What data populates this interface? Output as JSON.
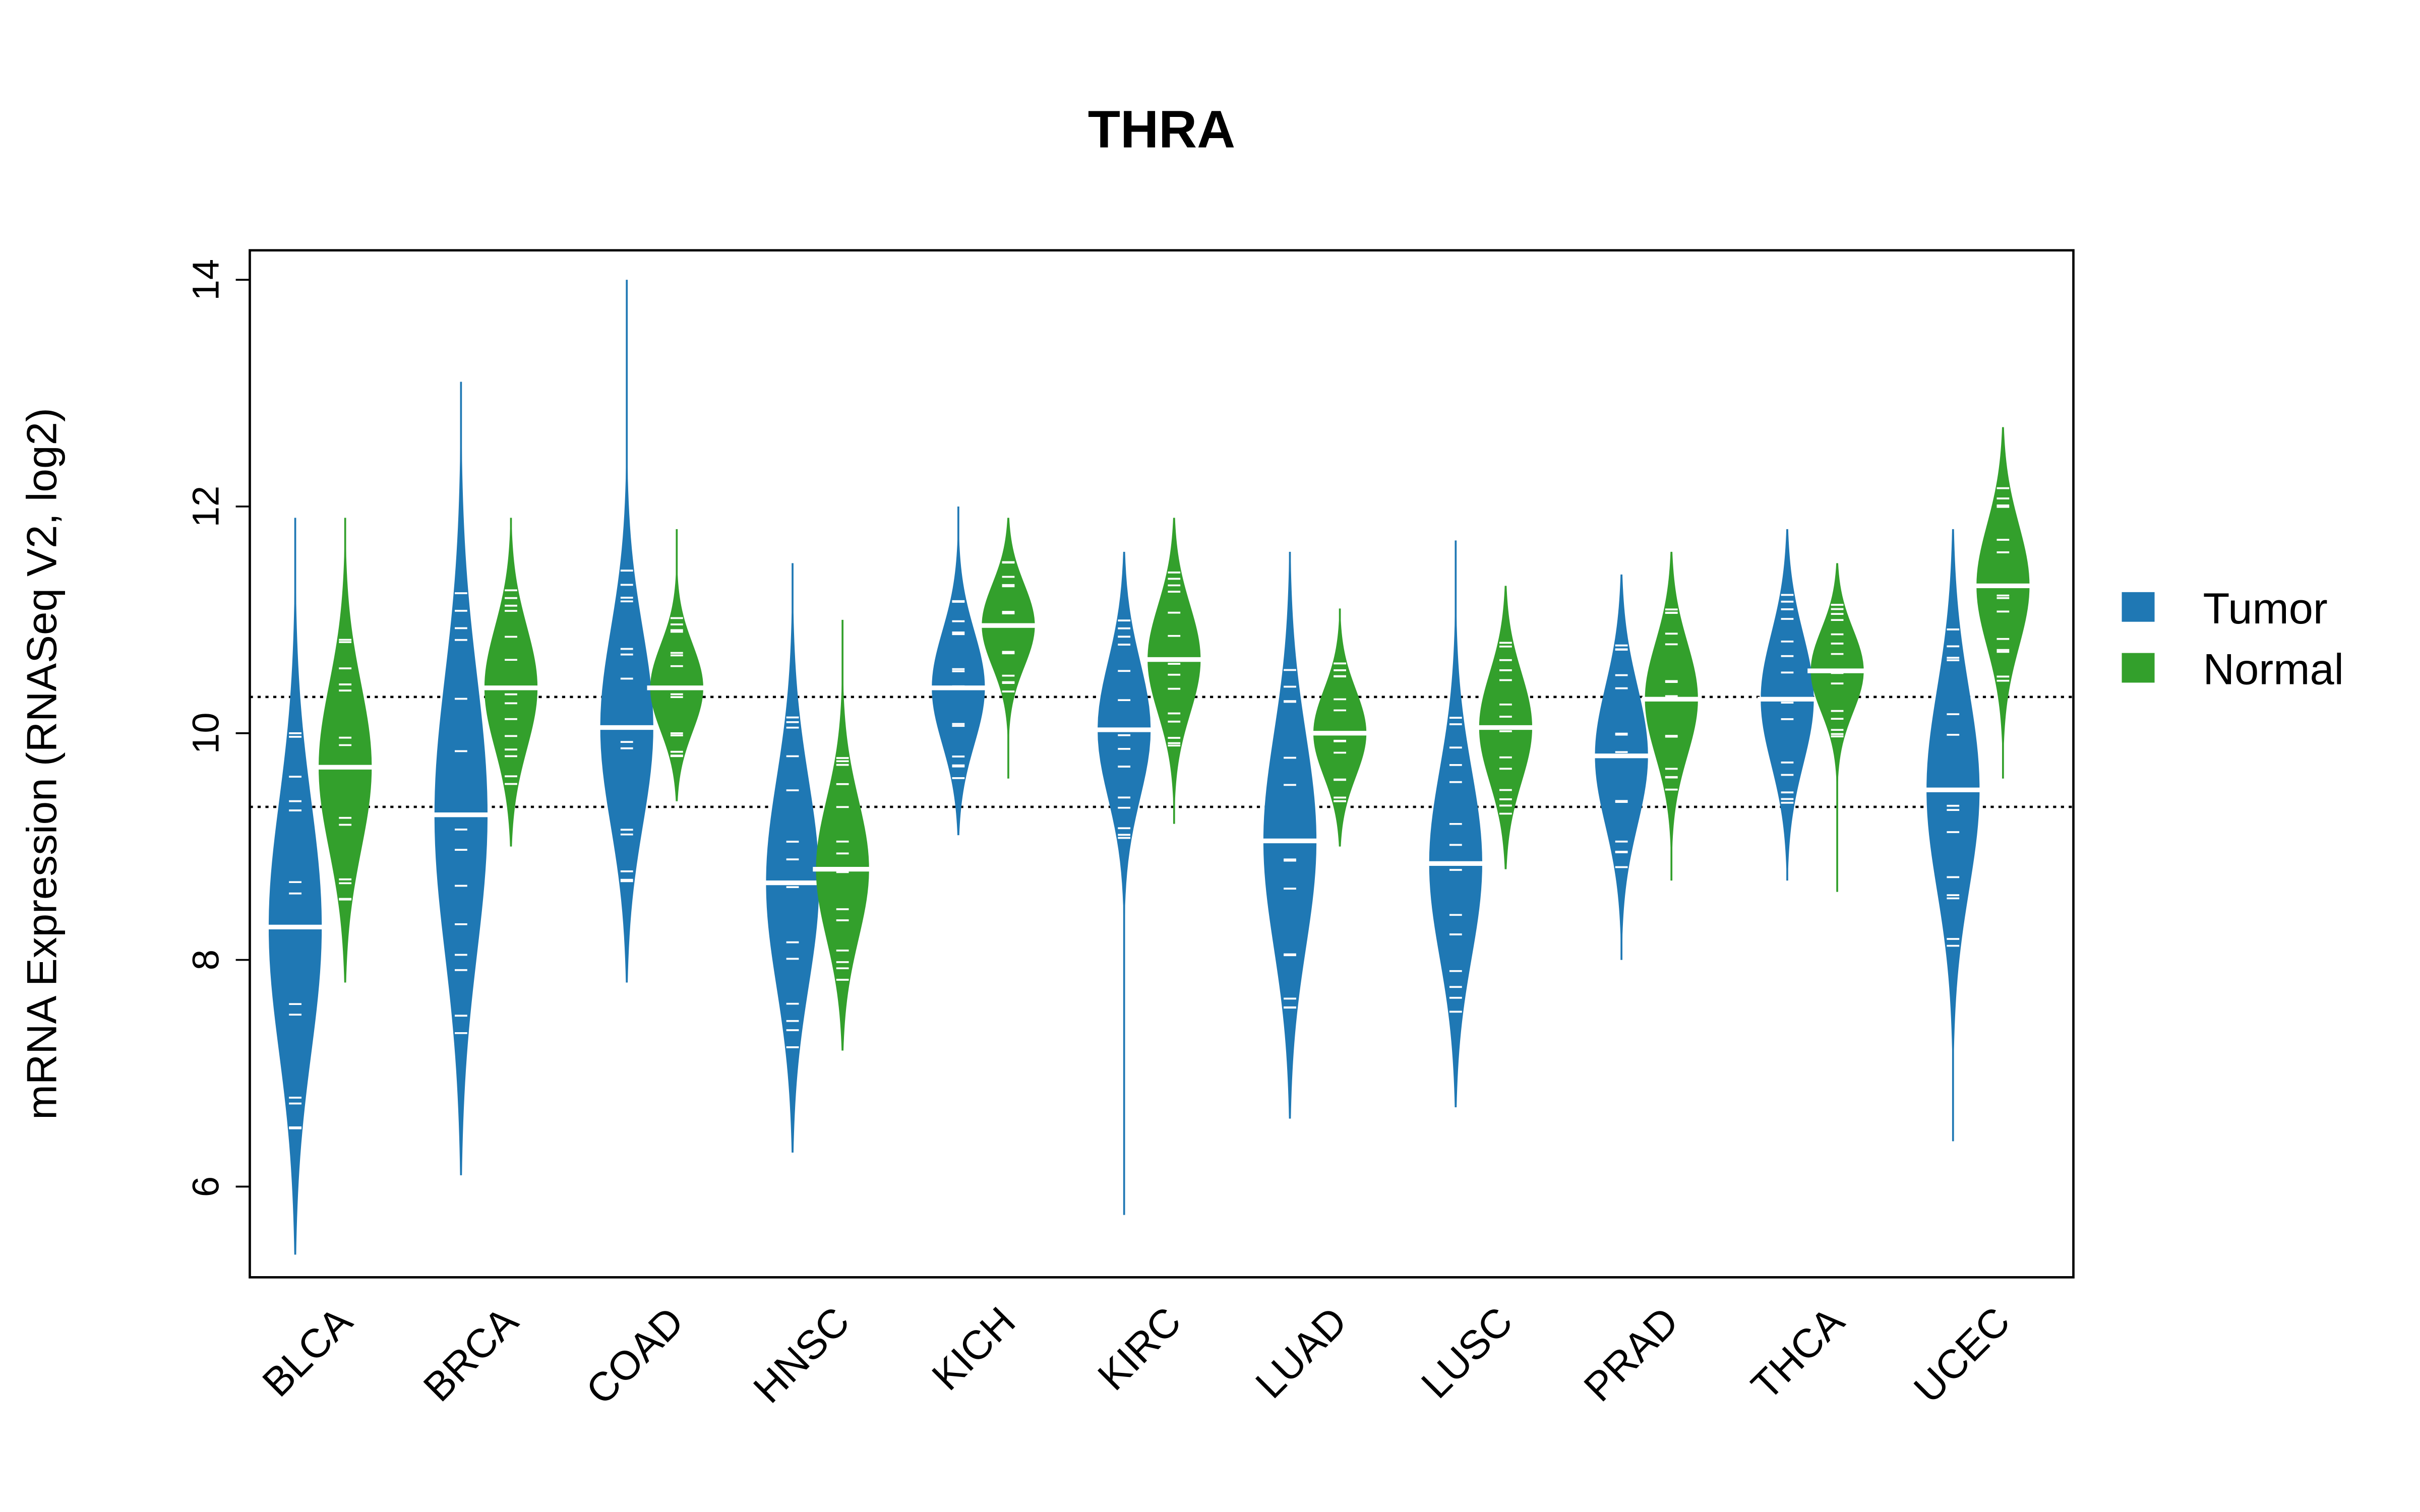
{
  "chart_data": {
    "type": "beanplot",
    "title": "THRA",
    "ylabel": "mRNA Expression (RNASeq V2, log2)",
    "xlabel": "",
    "ylim": [
      5.2,
      14.26
    ],
    "yticks": [
      6,
      8,
      10,
      12,
      14
    ],
    "categories": [
      "BLCA",
      "BRCA",
      "COAD",
      "HNSC",
      "KICH",
      "KIRC",
      "LUAD",
      "LUSC",
      "PRAD",
      "THCA",
      "UCEC"
    ],
    "reference_lines": [
      10.32,
      9.35
    ],
    "grid": false,
    "legend_position": "right",
    "series": [
      {
        "name": "Tumor",
        "color": "#1f78b4",
        "median": [
          8.29,
          9.28,
          10.05,
          8.68,
          10.4,
          10.03,
          9.05,
          8.85,
          9.8,
          10.3,
          9.5
        ],
        "min": [
          5.4,
          6.1,
          7.8,
          6.3,
          9.1,
          5.75,
          6.6,
          6.7,
          8.0,
          8.7,
          6.4
        ],
        "max": [
          11.9,
          13.1,
          14.0,
          11.5,
          12.0,
          11.6,
          11.6,
          11.7,
          11.4,
          11.8,
          11.8
        ]
      },
      {
        "name": "Normal",
        "color": "#33a02c",
        "median": [
          9.7,
          10.4,
          10.4,
          8.8,
          10.95,
          10.65,
          10.0,
          10.05,
          10.3,
          10.55,
          11.3
        ],
        "min": [
          7.8,
          9.0,
          9.4,
          7.2,
          9.6,
          9.2,
          9.0,
          8.8,
          8.7,
          8.6,
          9.6
        ],
        "max": [
          11.9,
          11.9,
          11.8,
          11.0,
          11.9,
          11.9,
          11.1,
          11.3,
          11.6,
          11.5,
          12.7
        ]
      }
    ]
  }
}
